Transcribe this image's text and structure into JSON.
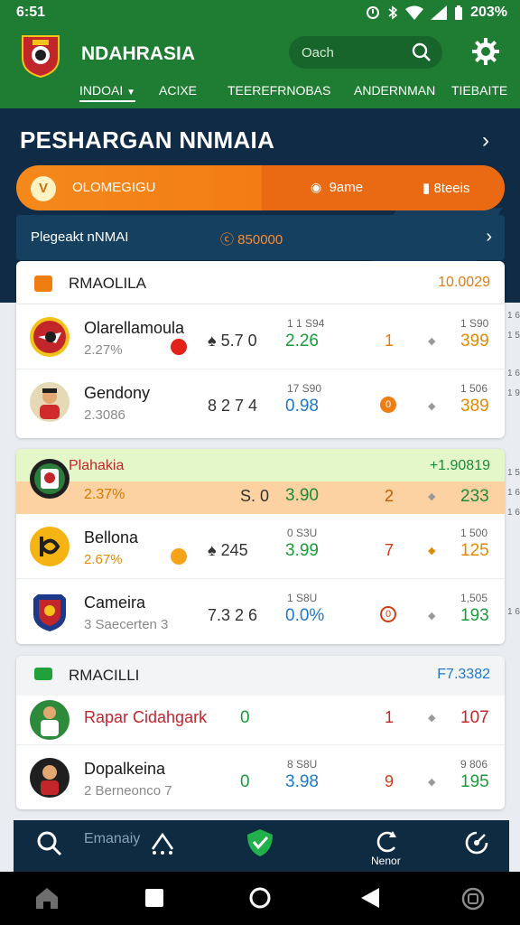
{
  "status": {
    "time": "6:51",
    "battery": "203%"
  },
  "app": {
    "title": "NDAHRASIA",
    "search_placeholder": "Oach"
  },
  "nav_tabs": [
    {
      "label": "INDOAI",
      "active": true
    },
    {
      "label": "ACIXE",
      "active": false
    },
    {
      "label": "TEEREFRNOBAS",
      "active": false
    },
    {
      "label": "ANDERNMAN",
      "active": false
    },
    {
      "label": "TIEBAITE",
      "active": false
    }
  ],
  "hero": {
    "title": "PESHARGAN NNMAIA",
    "pill": {
      "badge": "V",
      "left_text": "OLOMEGIGU",
      "mid_text": "9ame",
      "right_text": "8teeis"
    },
    "promo": {
      "label": "Plegeakt nNMAI",
      "value": "ⓒ 850000"
    }
  },
  "cards": [
    {
      "title": "RMAOLILA",
      "total": "10.0029",
      "icon_color": "#ef7d10",
      "total_color": "#e07a10",
      "rows": [
        {
          "name": "Olarellamoula",
          "sub": "2.27%",
          "dot": "#e3231b",
          "c1": "♠ 5.7 0",
          "c2_small": "1 1 S94",
          "c2": "2.26",
          "c2_color": "#1c9a3b",
          "c3": "1",
          "c3_color": "#e07a10",
          "c4_small": "1 S90",
          "c4": "399",
          "avatar": "#c2262b"
        },
        {
          "name": "Gendony",
          "sub": "2.3086",
          "dot": "",
          "c1": "8 2 7 4",
          "c2_small": "17 S90",
          "c2": "0.98",
          "c2_color": "#1f77c9",
          "c3": "0",
          "c3_color": "#ef7d10",
          "c4_small": "1 506",
          "c4": "389",
          "avatar": "#d9a441",
          "c3_badge": true
        }
      ]
    },
    {
      "title": "Plahakia",
      "total": "+1.90819",
      "icon_color": "",
      "total_color": "#1c8a3b",
      "rows": [
        {
          "name": "2.37%",
          "sub": "",
          "dot": "",
          "c1": "S. 0",
          "c2_small": "",
          "c2": "3.90",
          "c2_color": "#1c8a3b",
          "c3": "2",
          "c3_color": "#c35a00",
          "c4_small": "",
          "c4": "233",
          "avatar": "#1f1f1f",
          "highlight": true
        },
        {
          "name": "Bellona",
          "sub": "2.67%",
          "dot": "#f5a31a",
          "c1": "♠ 245",
          "c2_small": "0 S3U",
          "c2": "3.99",
          "c2_color": "#1c9a3b",
          "c3": "7",
          "c3_color": "#d23d16",
          "c4_small": "1 500",
          "c4": "125",
          "avatar": "#f5b413"
        },
        {
          "name": "Cameira",
          "sub": "3 Saecerten 3",
          "dot": "",
          "c1": "7.3 2 6",
          "c2_small": "1 S8U",
          "c2": "0.0%",
          "c2_color": "#1f77c9",
          "c3": "0",
          "c3_color": "#d23d16",
          "c4_small": "1,505",
          "c4": "193",
          "avatar": "#1d3a8a",
          "c3_badge_red": true
        }
      ]
    },
    {
      "title": "RMACILLI",
      "total": "F7.3382",
      "icon_color": "#22a03a",
      "total_color": "#1f77c9",
      "rows": [
        {
          "name": "Rapar Cidahgark",
          "sub": "",
          "dot": "",
          "c1": "",
          "c2_small": "",
          "c2": "0",
          "c2_color": "#1c9a3b",
          "c3": "1",
          "c3_color": "#c0262b",
          "c4_small": "",
          "c4": "107",
          "avatar": "#2c8a3a",
          "name_color": "#c0262b"
        },
        {
          "name": "Dopalkeina",
          "sub": "2 Berneonco 7",
          "dot": "",
          "c1": "",
          "c2_small": "8 S8U",
          "c2": "3.98",
          "c2_color": "#1f77c9",
          "c3": "9",
          "c3_color": "#d23d16",
          "c4_small": "9 806",
          "c4": "195",
          "avatar": "#1f1f1f"
        }
      ]
    }
  ],
  "right_rail": [
    "1 6",
    "1 5 6",
    "1 6",
    "1 9",
    "1 5",
    "1 6",
    "1 6",
    "1 6"
  ],
  "bottom_nav": {
    "items": [
      {
        "icon": "search-icon",
        "label": "Emanaiy"
      },
      {
        "icon": "route-icon",
        "label": ""
      },
      {
        "icon": "shield-check-icon",
        "label": ""
      },
      {
        "icon": "refresh-icon",
        "label": "Nenor"
      },
      {
        "icon": "compass-icon",
        "label": ""
      }
    ]
  },
  "system_nav": [
    "home-icon",
    "square-icon",
    "circle-icon",
    "back-icon",
    "accessibility-icon"
  ]
}
